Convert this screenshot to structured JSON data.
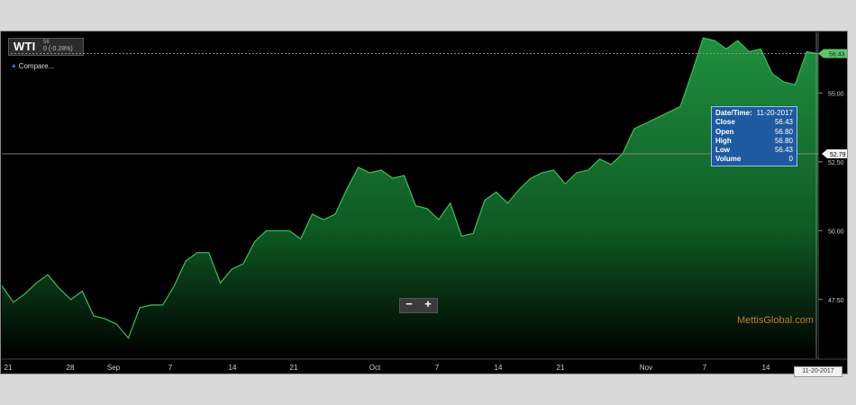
{
  "header": {
    "symbol": "WTI",
    "small_text": "56",
    "change_text": "0 (-0.28%)",
    "compare_label": "Compare..."
  },
  "zoom": {
    "minus_label": "−",
    "plus_label": "+"
  },
  "watermark": "MettisGlobal.com",
  "date_badge": "11-20-2017",
  "tooltip": {
    "rows": [
      {
        "k": "Date/Time:",
        "v": "11-20-2017"
      },
      {
        "k": "Close",
        "v": "56.43"
      },
      {
        "k": "Open",
        "v": "56.80"
      },
      {
        "k": "High",
        "v": "56.80"
      },
      {
        "k": "Low",
        "v": "56.43"
      },
      {
        "k": "Volume",
        "v": "0"
      }
    ]
  },
  "last_price_label": "56.43",
  "crosshair_label": "52.79",
  "colors": {
    "background": "#000000",
    "line": "#3cbf5c",
    "area_top": "#1f8f3e",
    "area_bottom": "#000000",
    "tooltip_bg": "#1f5aa0",
    "watermark": "#c27d2a"
  },
  "chart_data": {
    "type": "area",
    "title": "",
    "xlabel": "",
    "ylabel": "",
    "ylim": [
      45.4,
      57.2
    ],
    "yticks": [
      "47.50",
      "50.00",
      "52.50",
      "55.00"
    ],
    "xticks": [
      "21",
      "28",
      "Sep",
      "7",
      "14",
      "21",
      "Oct",
      "7",
      "14",
      "21",
      "Nov",
      "7",
      "14"
    ],
    "crosshair_value": 52.79,
    "last_value": 56.43,
    "series": [
      {
        "values": [
          48.0,
          47.4,
          47.7,
          48.1,
          48.4,
          47.9,
          47.5,
          47.8,
          46.9,
          46.8,
          46.6,
          46.1,
          47.2,
          47.3,
          47.3,
          48.0,
          48.9,
          49.2,
          49.2,
          48.1,
          48.6,
          48.8,
          49.6,
          50.0,
          50.0,
          50.0,
          49.7,
          50.6,
          50.4,
          50.6,
          51.5,
          52.3,
          52.1,
          52.2,
          51.9,
          52.0,
          50.9,
          50.8,
          50.4,
          51.0,
          49.8,
          49.9,
          51.1,
          51.4,
          51.0,
          51.5,
          51.9,
          52.1,
          52.2,
          51.7,
          52.1,
          52.2,
          52.6,
          52.4,
          52.8,
          53.7,
          53.9,
          54.1,
          54.3,
          54.5,
          55.7,
          57.0,
          56.9,
          56.6,
          56.9,
          56.5,
          56.6,
          55.7,
          55.4,
          55.3,
          56.5,
          56.43
        ]
      }
    ]
  }
}
